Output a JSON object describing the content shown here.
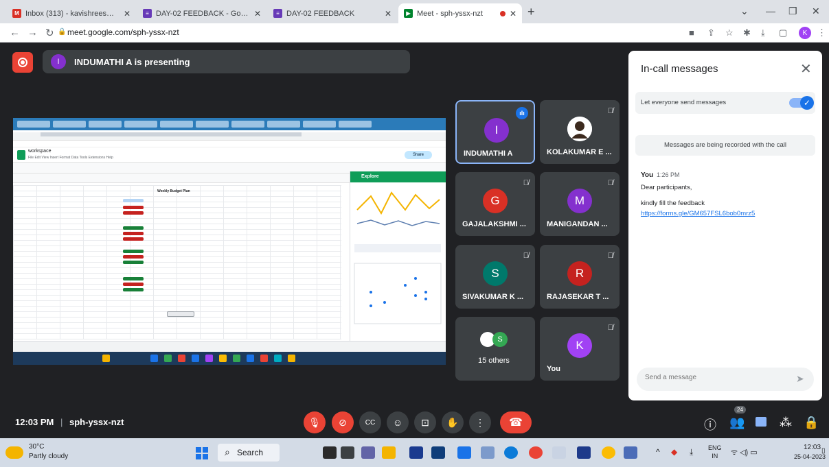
{
  "browser": {
    "tabs": [
      {
        "label": "Inbox (313) - kavishrees@svce.a",
        "icon": "gmail-icon",
        "color": "#d93025"
      },
      {
        "label": "DAY-02 FEEDBACK - Google Form",
        "icon": "forms-icon",
        "color": "#673ab7"
      },
      {
        "label": "DAY-02 FEEDBACK",
        "icon": "forms-icon",
        "color": "#673ab7"
      },
      {
        "label": "Meet - sph-yssx-nzt",
        "icon": "meet-icon",
        "color": "#00832d"
      }
    ],
    "url": "meet.google.com/sph-yssx-nzt",
    "profile_initial": "K"
  },
  "meet": {
    "presenting_text": "INDUMATHI A is presenting",
    "presenter_initial": "I",
    "meeting_time": "12:03 PM",
    "meeting_code": "sph-yssx-nzt",
    "people_count": "24",
    "participants": [
      {
        "name": "INDUMATHI A",
        "initial": "I",
        "color": "#8430ce",
        "speaking": true
      },
      {
        "name": "KOLAKUMAR E ...",
        "initial": "",
        "color": "#5f6368",
        "photo": true
      },
      {
        "name": "GAJALAKSHMI ...",
        "initial": "G",
        "color": "#d93025"
      },
      {
        "name": "MANIGANDAN ...",
        "initial": "M",
        "color": "#8430ce"
      },
      {
        "name": "SIVAKUMAR K ...",
        "initial": "S",
        "color": "#00796b"
      },
      {
        "name": "RAJASEKAR T ...",
        "initial": "R",
        "color": "#c5221f"
      },
      {
        "name": "15 others",
        "initial": "S",
        "color": "#34a853"
      },
      {
        "name": "You",
        "initial": "K",
        "color": "#a142f4"
      }
    ]
  },
  "shared_screen": {
    "doc_name": "workspace",
    "sheet_title": "Weekly Budget Plan",
    "explore_label": "Explore",
    "share_label": "Share"
  },
  "chat": {
    "title": "In-call messages",
    "allow_label": "Let everyone send messages",
    "recording_note": "Messages are being recorded with the call",
    "messages": [
      {
        "sender": "You",
        "time": "1:26 PM",
        "lines": [
          "Dear participants,",
          "kindly fill the feedback"
        ],
        "link": "https://forms.gle/GM657FSL6bob0mrz5"
      }
    ],
    "input_placeholder": "Send a message"
  },
  "taskbar": {
    "temperature": "30°C",
    "weather": "Partly cloudy",
    "search_label": "Search",
    "lang_top": "ENG",
    "lang_bottom": "IN",
    "time": "12:03",
    "date": "25-04-2023"
  }
}
